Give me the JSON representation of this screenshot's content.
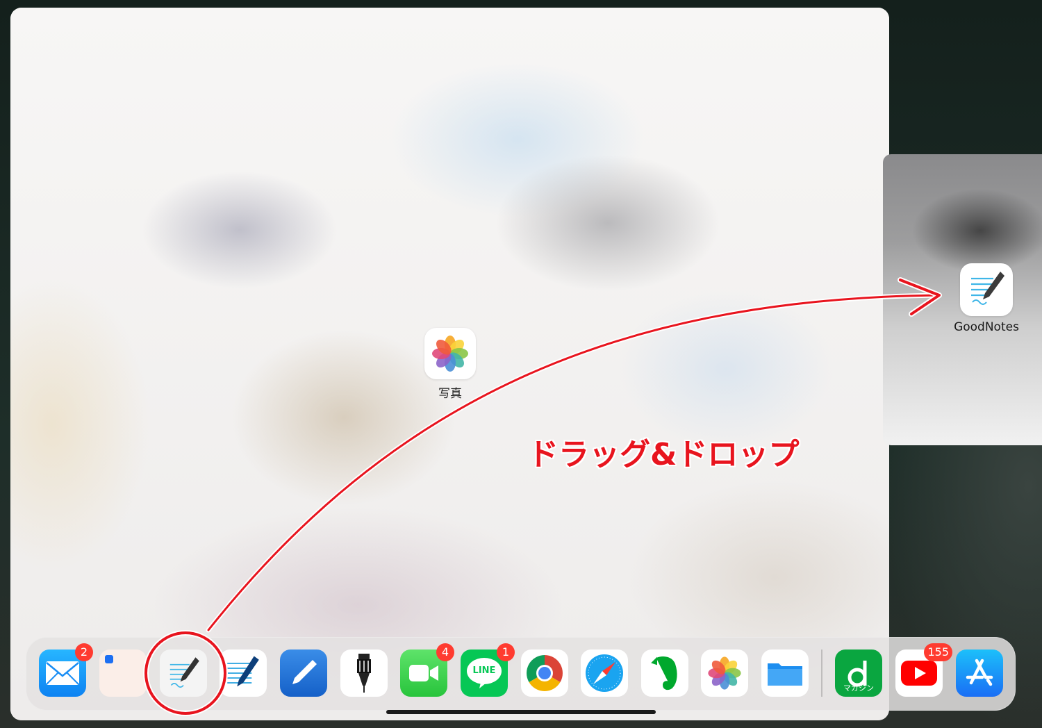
{
  "main_window": {
    "center_app": {
      "label": "写真",
      "icon": "photos-icon"
    }
  },
  "side_panel": {
    "app": {
      "label": "GoodNotes",
      "icon": "goodnotes-icon"
    }
  },
  "annotation": {
    "text": "ドラッグ&ドロップ",
    "color": "#e8141e"
  },
  "dock": {
    "apps": [
      {
        "name": "mail",
        "icon": "mail-icon",
        "badge": "2"
      },
      {
        "name": "blank-app",
        "icon": "blank-app-icon",
        "badge": ""
      },
      {
        "name": "goodnotes",
        "icon": "goodnotes-icon",
        "badge": ""
      },
      {
        "name": "notes-pen",
        "icon": "notes-pen-icon",
        "badge": ""
      },
      {
        "name": "pen-app",
        "icon": "pen-app-icon",
        "badge": ""
      },
      {
        "name": "pen-nib",
        "icon": "pen-nib-icon",
        "badge": ""
      },
      {
        "name": "facetime",
        "icon": "facetime-icon",
        "badge": "4"
      },
      {
        "name": "line",
        "icon": "line-icon",
        "badge": "1",
        "text": "LINE"
      },
      {
        "name": "chrome",
        "icon": "chrome-icon",
        "badge": ""
      },
      {
        "name": "safari",
        "icon": "safari-icon",
        "badge": ""
      },
      {
        "name": "evernote",
        "icon": "evernote-icon",
        "badge": ""
      },
      {
        "name": "photos",
        "icon": "photos-icon",
        "badge": ""
      },
      {
        "name": "files",
        "icon": "files-icon",
        "badge": ""
      },
      {
        "name": "d-magazine",
        "icon": "d-magazine-icon",
        "badge": "",
        "text": "マガジン"
      },
      {
        "name": "youtube",
        "icon": "youtube-icon",
        "badge": "155"
      },
      {
        "name": "app-store",
        "icon": "app-store-icon",
        "badge": ""
      }
    ]
  },
  "colors": {
    "badge": "#ff3b30",
    "annotation_red": "#e8141e"
  }
}
